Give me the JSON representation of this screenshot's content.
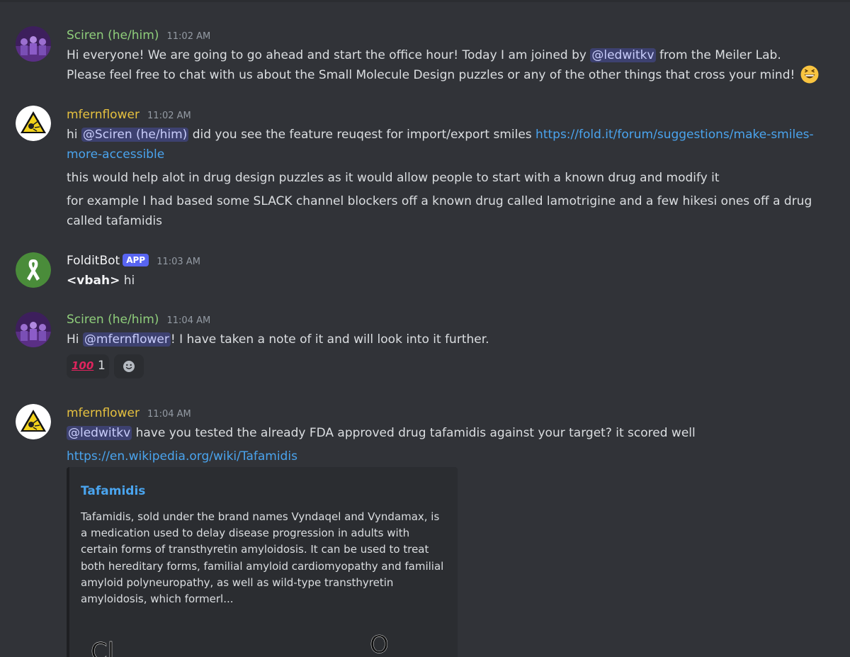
{
  "messages": [
    {
      "username": "Sciren (he/him)",
      "timestamp": "11:02 AM",
      "line1_a": "Hi everyone!  We are going to go ahead and start the office hour!  Today I am joined by ",
      "line1_mention": "@ledwitkv",
      "line1_b": " from the Meiler Lab.",
      "line2": "Please feel free to chat with us about the Small Molecule Design puzzles or any of the other things that cross your mind! ",
      "emoji": "grinning-face-emoji"
    },
    {
      "username": "mfernflower",
      "timestamp": "11:02 AM",
      "p1_a": "hi ",
      "p1_mention": "@Sciren (he/him)",
      "p1_b": " did you see the feature reuqest for import/export smiles ",
      "p1_link": "https://fold.it/forum/suggestions/make-smiles-more-accessible",
      "p2": "this would help alot in drug design puzzles as it would allow people to start with a known drug and modify it",
      "p3": "for example I had based some SLACK channel blockers off a known drug called lamotrigine and a few hikesi ones off a drug called tafamidis"
    },
    {
      "username": "FolditBot",
      "badge": "APP",
      "timestamp": "11:03 AM",
      "bold": "<vbah>",
      "text": " hi"
    },
    {
      "username": "Sciren (he/him)",
      "timestamp": "11:04 AM",
      "a": "Hi ",
      "mention": "@mfernflower",
      "b": "!  I have taken a note of it and will look into it further.",
      "reactions": [
        {
          "emoji": "100",
          "count": "1"
        }
      ],
      "add_reaction_icon": "add-reaction-icon"
    },
    {
      "username": "mfernflower",
      "timestamp": "11:04 AM",
      "mention": "@ledwitkv",
      "text": " have you tested the already FDA approved drug tafamidis against your target? it scored well",
      "link": "https://en.wikipedia.org/wiki/Tafamidis",
      "embed": {
        "title": "Tafamidis",
        "description": "Tafamidis, sold under the brand names Vyndaqel and Vyndamax, is a medication used to delay disease progression in adults with certain forms of transthyretin amyloidosis. It can be used to treat both hereditary forms, familial amyloid cardiomyopathy and familial amyloid polyneuropathy, as well as wild-type transthyretin amyloidosis, which formerl...",
        "image_labels": [
          "Cl",
          "O"
        ]
      }
    }
  ],
  "colors": {
    "background": "#313338",
    "sciren_name": "#8fce7b",
    "mfernflower_name": "#e6c13f",
    "link": "#4aa4ee",
    "mention_bg": "#3c4270",
    "app_badge": "#5865f2"
  }
}
